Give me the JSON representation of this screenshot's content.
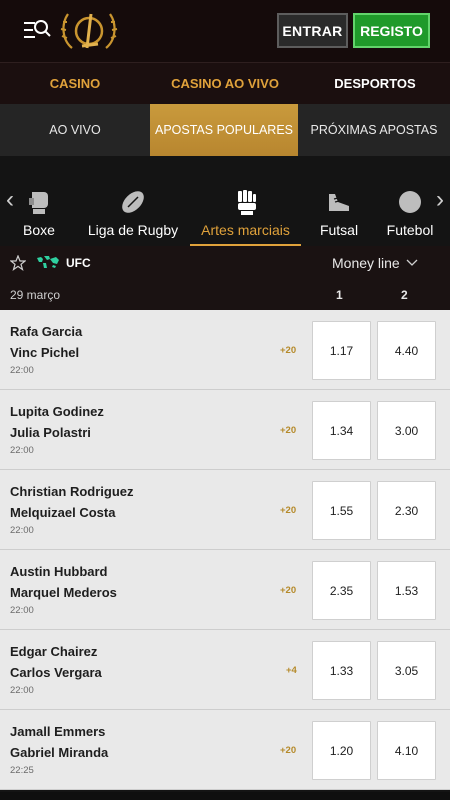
{
  "header": {
    "entrar_label": "ENTRAR",
    "registo_label": "REGISTO"
  },
  "main_nav": {
    "items": [
      {
        "label": "CASINO"
      },
      {
        "label": "CASINO AO VIVO"
      },
      {
        "label": "DESPORTOS"
      }
    ]
  },
  "sub_nav": {
    "tabs": [
      {
        "label": "AO VIVO"
      },
      {
        "label": "APOSTAS POPULARES",
        "active": true
      },
      {
        "label": "PRÓXIMAS APOSTAS"
      }
    ]
  },
  "sports": [
    {
      "label": "Boxe",
      "icon": "boxing-glove-icon"
    },
    {
      "label": "Liga de Rugby",
      "icon": "rugby-ball-icon"
    },
    {
      "label": "Artes marciais",
      "icon": "martial-arts-fist-icon",
      "active": true
    },
    {
      "label": "Futsal",
      "icon": "futsal-shoe-icon"
    },
    {
      "label": "Futebol",
      "icon": "football-icon"
    }
  ],
  "competition": {
    "name": "UFC",
    "market": "Money line",
    "date": "29 março",
    "col1": "1",
    "col2": "2"
  },
  "events": [
    {
      "home": "Rafa Garcia",
      "away": "Vinc Pichel",
      "time": "22:00",
      "more": "+20",
      "odd1": "1.17",
      "odd2": "4.40"
    },
    {
      "home": "Lupita Godinez",
      "away": "Julia Polastri",
      "time": "22:00",
      "more": "+20",
      "odd1": "1.34",
      "odd2": "3.00"
    },
    {
      "home": "Christian Rodriguez",
      "away": "Melquizael Costa",
      "time": "22:00",
      "more": "+20",
      "odd1": "1.55",
      "odd2": "2.30"
    },
    {
      "home": "Austin Hubbard",
      "away": "Marquel Mederos",
      "time": "22:00",
      "more": "+20",
      "odd1": "2.35",
      "odd2": "1.53"
    },
    {
      "home": "Edgar Chairez",
      "away": "Carlos Vergara",
      "time": "22:00",
      "more": "+4",
      "odd1": "1.33",
      "odd2": "3.05"
    },
    {
      "home": "Jamall Emmers",
      "away": "Gabriel Miranda",
      "time": "22:25",
      "more": "+20",
      "odd1": "1.20",
      "odd2": "4.10"
    }
  ],
  "colors": {
    "accent_gold": "#e0a23b",
    "register_green": "#1f9a2a",
    "more_markets": "#b58a2a"
  }
}
